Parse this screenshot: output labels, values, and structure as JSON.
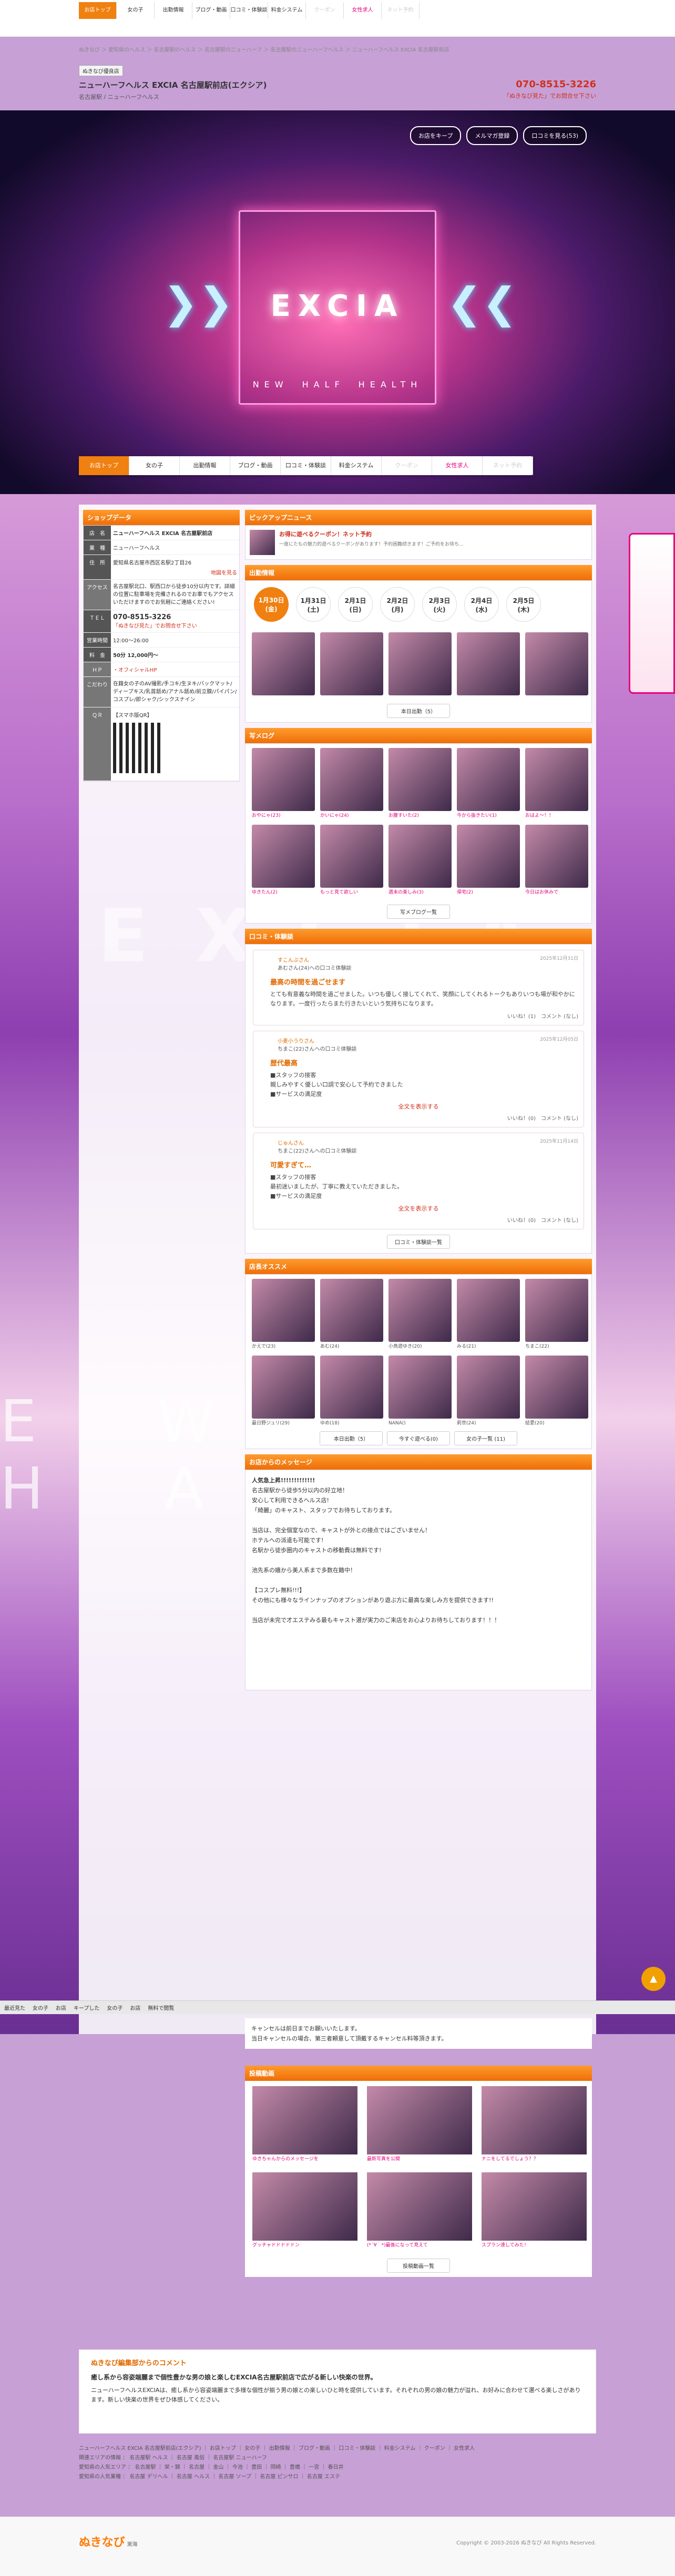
{
  "nav": [
    "お店トップ",
    "女の子",
    "出勤情報",
    "ブログ・動画",
    "口コミ・体験談",
    "料金システム",
    "クーポン",
    "女性求人",
    "ネット予約"
  ],
  "crumb": "ぬきなび ＞ 愛知県のヘルス ＞ 名古屋駅のヘルス ＞ 名古屋駅のニューハーフ ＞ 名古屋駅のニューハーフヘルス ＞ ニューハーフヘルス EXCIA 名古屋駅前店",
  "shop": {
    "tag": "ぬきなび優良店",
    "name": "ニューハーフヘルス EXCIA 名古屋駅前店(エクシア)",
    "sub": "名古屋駅 / ニューハーフヘルス",
    "tel": "070-8515-3226",
    "telsub": "「ぬきなび見た」でお問合せ下さい"
  },
  "hero": {
    "logo": "EXCIA",
    "tag": "NEW　HALF　HEALTH",
    "btns": [
      "お店をキープ",
      "メルマガ登録",
      "口コミを見る(53)"
    ]
  },
  "shopdata": {
    "title": "ショップデータ",
    "rows": [
      [
        "店　名",
        "ニューハーフヘルス EXCIA 名古屋駅前店"
      ],
      [
        "業　種",
        "ニューハーフヘルス"
      ],
      [
        "住　所",
        "愛知県名古屋市西区名駅2丁目26"
      ],
      [
        "アクセス",
        "名古屋駅北口、駅西口から徒歩10分以内です。詳細の位置に駐車場を完備されるのでお車でもアクセスいただけますのでお気軽にご連絡ください!"
      ],
      [
        "ＴＥＬ",
        "070-8515-3226"
      ],
      [
        "営業時間",
        "12:00～26:00"
      ],
      [
        "料　金",
        "50分 12,000円～"
      ],
      [
        "ＨＰ",
        "・オフィシャルHP"
      ],
      [
        "こだわり",
        "在籍女の子のAV撮影/手コキ/生ヌキ/バックマット/ディープキス/乳首舐め/アナル舐め/前立腺/パイパン/コスプレ/即シャク/シックスナイン"
      ],
      [
        "ＱＲ",
        "【スマホ版QR】"
      ]
    ],
    "map": "地図を見る",
    "telnote": "「ぬきなび見た」でお問合せ下さい"
  },
  "pickup": {
    "title": "ピックアップニュース",
    "headline": "お得に遊べるクーポン！ネット予約",
    "desc": "一度にたもの魅力的遊べるクーポンがあります！予約困難続きます！ご予約をお待ち..."
  },
  "schedule": {
    "title": "出勤情報",
    "dates": [
      [
        "1月30日",
        "(金)"
      ],
      [
        "1月31日",
        "(土)"
      ],
      [
        "2月1日",
        "(日)"
      ],
      [
        "2月2日",
        "(月)"
      ],
      [
        "2月3日",
        "(火)"
      ],
      [
        "2月4日",
        "(水)"
      ],
      [
        "2月5日",
        "(木)"
      ]
    ],
    "more": "本日出勤（5）"
  },
  "blog": {
    "title": "写メログ",
    "items": [
      "おやにゃ(23)",
      "かいにゃ(24)",
      "お腹すいた(2)",
      "今から抜きたい(1)",
      "おはよ〜！！",
      "ゆきたん(2)",
      "もっと見て欲しい",
      "週末の楽しみ(3)",
      "帰宅(2)",
      "今日はお休みで"
    ],
    "more": "写メブログ一覧"
  },
  "reviews": {
    "title": "口コミ・体験談",
    "list": [
      {
        "who": "すこんぶさん",
        "to": "あむさん(24)への口コミ体験談",
        "date": "2025年12月31日",
        "ttl": "最高の時間を過ごせます",
        "body": "とても有意義な時間を過ごせました。いつも優しく接してくれて、笑顔にしてくれるトークもありいつも場が和やかになります。一度行ったらまた行きたいという気持ちになります。",
        "likes": "いいね！(1)　コメント (なし)"
      },
      {
        "who": "小麦小うりさん",
        "to": "ちまこ(22)さんへの口コミ体験談",
        "date": "2025年12月05日",
        "ttl": "歴代最高",
        "body": "■スタッフの接客\n親しみやすく優しい口調で安心して予約できました\n■サービスの満足度",
        "likes": "いいね！(0)　コメント (なし)"
      },
      {
        "who": "じゅんさん",
        "to": "ちまこ(22)さんへの口コミ体験談",
        "date": "2025年11月14日",
        "ttl": "可愛すぎて…",
        "body": "■スタッフの接客\n最初迷いましたが、丁寧に教えていただきました。\n■サービスの満足度",
        "likes": "いいね！(0)　コメント (なし)"
      }
    ],
    "more": "口コミ・体験談一覧",
    "open": "全文を表示する"
  },
  "staff": {
    "title": "店長オススメ",
    "names": [
      "かえで(23)",
      "あむ(24)",
      "小鳥遊ゆき(20)",
      "みる(21)",
      "ちまこ(22)",
      "最日野ジュリ(29)",
      "ゆめ(18)",
      "NANA()",
      "莉世(24)",
      "結愛(20)"
    ],
    "btns": [
      "本日出勤（5）",
      "今すぐ遊べる(0)",
      "女の子一覧 (11)"
    ]
  },
  "message": {
    "title": "お店からのメッセージ",
    "lines": [
      "人気急上昇!!!!!!!!!!!!!",
      "名古屋駅から徒歩5分以内の好立地！",
      "安心して利用できるヘルス店!",
      "「綺麗」のキャスト、スタッフでお待ちしております。",
      "当店は、完全個室なので、キャストが外との接点ではございません！",
      "ホテルへの派遣も可能です!",
      "名駅から徒歩圏内のキャストの移動費は無料です!",
      "池先系の嬉から美人系まで多数在籍中！",
      "【コスプレ無料!!!】",
      "その他にも様々なラインナップのオプションがあり遊ぶ方に最高な楽しみ方を提供できます!!",
      "当店が未完で才エステみる最もキャスト選が実力のご来店をお心よりお待ちしております！！！",
      "キャンセルは前日までお願いいたします。",
      "当日キャンセルの場合、第三者頼意して頂戴するキャンセル料等頂きます。"
    ]
  },
  "girls": {
    "title": "投稿動画",
    "items": [
      "ゆきちゃんからのメッセージを",
      "最新写真を公開",
      "ナニをしてるでしょう？？",
      "グッチャドドドドドン",
      "(*´∀｀*)最後になって見えて",
      "スプラン速してみた！"
    ],
    "more": "投稿動画一覧"
  },
  "ward": {
    "title": "ぬきなび編集部からのコメント",
    "head": "癒し系から容姿端麗まで個性豊かな男の娘と楽しむEXCIA名古屋駅前店で広がる新しい快楽の世界。",
    "body": "ニューハーフヘルスEXCIAは、癒し系から容姿端麗まで多様な個性が揃う男の娘との楽しいひと時を提供しています。それぞれの男の娘の魅力が溢れ、お好みに合わせて選べる楽しさがあります。新しい快楽の世界をぜひ体感してください。"
  },
  "footer": {
    "l1": "ニューハーフヘルス EXCIA 名古屋駅前店(エクシア) ｜ お店トップ ｜ 女の子 ｜ 出勤情報 ｜ ブログ・動画 ｜ 口コミ・体験談 ｜ 料金システム ｜ クーポン ｜ 女性求人",
    "l2": "関連エリアの情報 ： 名古屋駅 ヘルス ｜ 名古屋 風俗 ｜ 名古屋駅 ニューハーフ",
    "l3": "愛知県の人気エリア ： 名古屋駅 ｜ 栄・錦 ｜ 名古屋 ｜ 金山 ｜ 今池 ｜ 豊田 ｜ 岡崎 ｜ 豊橋 ｜ 一宮 ｜ 春日井",
    "l4": "愛知県の人気業種 ： 名古屋 デリヘル ｜ 名古屋 ヘルス ｜ 名古屋 ソープ ｜ 名古屋 ピンサロ ｜ 名古屋 エステ",
    "copy": "Copyright © 2003-2026 ぬきなび All Rights Reserved."
  },
  "sticky": [
    "最近見た",
    "女の子",
    "お店",
    "キープした",
    "女の子",
    "お店",
    "無料で閲覧"
  ],
  "colors": {
    "accent": "#f08010",
    "pink": "#e6007e",
    "red": "#d0301c"
  }
}
